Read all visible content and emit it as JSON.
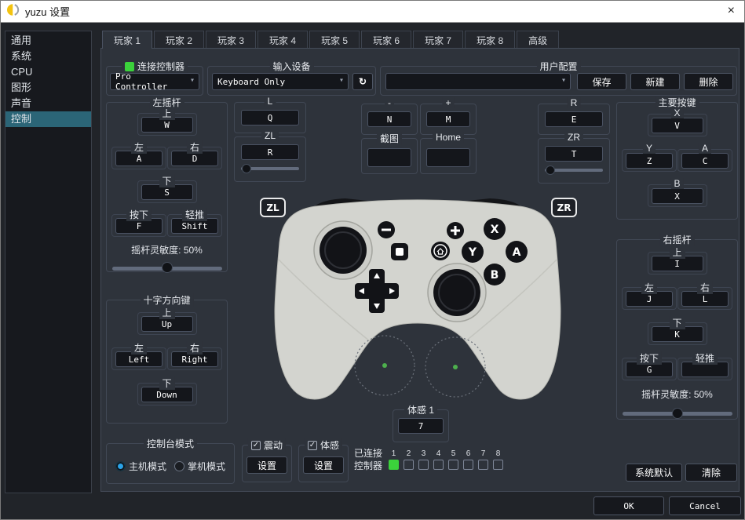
{
  "window": {
    "title": "yuzu 设置"
  },
  "icons": {
    "close": "×",
    "dropdown_arrow": "▾",
    "refresh": "↻",
    "check": "✓"
  },
  "sidebar": {
    "items": [
      {
        "label": "通用"
      },
      {
        "label": "系统"
      },
      {
        "label": "CPU"
      },
      {
        "label": "图形"
      },
      {
        "label": "声音"
      },
      {
        "label": "控制"
      }
    ]
  },
  "tabs": {
    "items": [
      "玩家 1",
      "玩家 2",
      "玩家 3",
      "玩家 4",
      "玩家 5",
      "玩家 6",
      "玩家 7",
      "玩家 8",
      "高级"
    ]
  },
  "top": {
    "connect": {
      "title": "连接控制器",
      "value": "Pro Controller"
    },
    "input_device": {
      "title": "输入设备",
      "value": "Keyboard Only"
    },
    "profile": {
      "title": "用户配置",
      "value": "",
      "save": "保存",
      "create": "新建",
      "remove": "删除"
    }
  },
  "groups": {
    "left_stick": {
      "title": "左摇杆",
      "up_label": "上",
      "up": "W",
      "left_label": "左",
      "left": "A",
      "right_label": "右",
      "right": "D",
      "down_label": "下",
      "down": "S",
      "press_label": "按下",
      "press": "F",
      "modifier_label": "轻推",
      "modifier": "Shift",
      "sensitivity": "摇杆灵敏度: 50%"
    },
    "dpad": {
      "title": "十字方向键",
      "up_label": "上",
      "up": "Up",
      "left_label": "左",
      "left": "Left",
      "right_label": "右",
      "right": "Right",
      "down_label": "下",
      "down": "Down"
    },
    "console_mode": {
      "title": "控制台模式",
      "docked": "主机模式",
      "handheld": "掌机模式"
    },
    "l": {
      "title": "L",
      "key": "Q"
    },
    "zl": {
      "title": "ZL",
      "key": "R"
    },
    "minus": {
      "title": "-",
      "key": "N"
    },
    "plus": {
      "title": "+",
      "key": "M"
    },
    "capture": {
      "title": "截图",
      "key": ""
    },
    "home": {
      "title": "Home",
      "key": ""
    },
    "r": {
      "title": "R",
      "key": "E"
    },
    "zr": {
      "title": "ZR",
      "key": "T"
    },
    "main_buttons": {
      "title": "主要按键",
      "x_label": "X",
      "x": "V",
      "y_label": "Y",
      "y": "Z",
      "a_label": "A",
      "a": "C",
      "b_label": "B",
      "b": "X"
    },
    "right_stick": {
      "title": "右摇杆",
      "up_label": "上",
      "up": "I",
      "left_label": "左",
      "left": "J",
      "right_label": "右",
      "right": "L",
      "down_label": "下",
      "down": "K",
      "press_label": "按下",
      "press": "G",
      "modifier_label": "轻推",
      "modifier": "",
      "sensitivity": "摇杆灵敏度: 50%"
    },
    "motion1": {
      "title": "体感 1",
      "key": "7"
    },
    "vibration": {
      "title": "震动",
      "button": "设置"
    },
    "motion_toggle": {
      "title": "体感",
      "button": "设置"
    },
    "connected": {
      "line1": "已连接",
      "line2": "控制器",
      "numbers": [
        "1",
        "2",
        "3",
        "4",
        "5",
        "6",
        "7",
        "8"
      ]
    }
  },
  "controller": {
    "zl_badge": "ZL",
    "zr_badge": "ZR",
    "x": "X",
    "y": "Y",
    "a": "A",
    "b": "B"
  },
  "footer": {
    "defaults": "系统默认",
    "clear": "清除",
    "ok": "OK",
    "cancel": "Cancel"
  },
  "colors": {
    "accent_green": "#3bd23b",
    "sidebar_selection": "#2b6577",
    "radio_blue": "#2aa3e8"
  }
}
